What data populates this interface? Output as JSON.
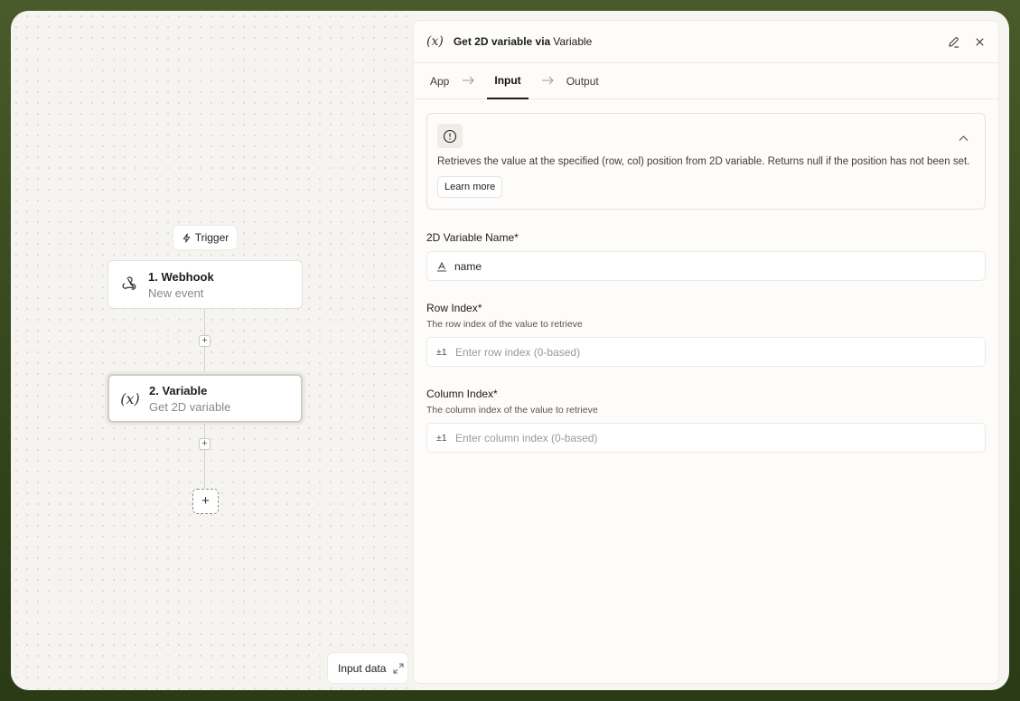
{
  "canvas": {
    "trigger_label": "Trigger",
    "nodes": [
      {
        "title": "1. Webhook",
        "subtitle": "New event"
      },
      {
        "title": "2. Variable",
        "subtitle": "Get 2D variable"
      }
    ],
    "input_data_label": "Input data"
  },
  "panel": {
    "title": "Get 2D variable via",
    "app_name": "Variable",
    "tabs": [
      {
        "label": "App"
      },
      {
        "label": "Input",
        "active": true
      },
      {
        "label": "Output"
      }
    ],
    "info": {
      "text": "Retrieves the value at the specified (row, col) position from 2D variable. Returns null if the position has not been set.",
      "learn_more": "Learn more"
    },
    "fields": {
      "name": {
        "label": "2D Variable Name*",
        "value": "name"
      },
      "row": {
        "label": "Row Index*",
        "description": "The row index of the value to retrieve",
        "prefix": "±1",
        "placeholder": "Enter row index (0-based)"
      },
      "column": {
        "label": "Column Index*",
        "description": "The column index of the value to retrieve",
        "prefix": "±1",
        "placeholder": "Enter column index (0-based)"
      }
    }
  }
}
